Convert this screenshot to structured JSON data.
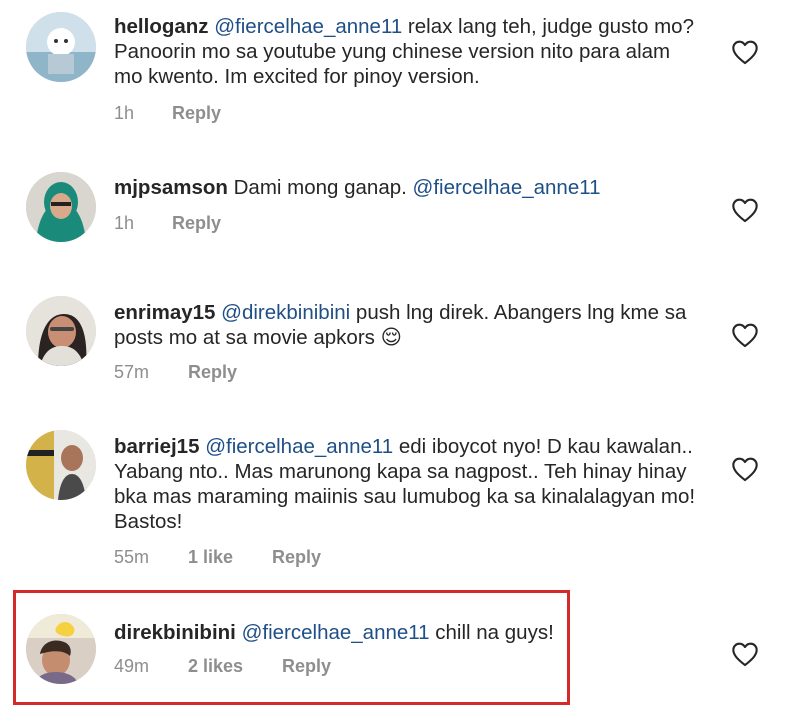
{
  "comments": [
    {
      "username": "helloganz",
      "mention": "@fiercelhae_anne11",
      "text": " relax lang teh, judge gusto mo? Panoorin mo sa youtube yung chinese version nito para alam mo kwento. Im excited for  pinoy version.",
      "time": "1h",
      "likes": "",
      "reply_label": "Reply",
      "avatar_icon": "cartoon-avatar"
    },
    {
      "username": "mjpsamson",
      "mention": "",
      "text": " Dami mong ganap. ",
      "mention_after": "@fiercelhae_anne11",
      "time": "1h",
      "likes": "",
      "reply_label": "Reply",
      "avatar_icon": "person-avatar"
    },
    {
      "username": "enrimay15",
      "mention": "@direkbinibini",
      "text": " push lng direk. Abangers lng kme sa posts mo at sa movie apkors 😌",
      "time": "57m",
      "likes": "",
      "reply_label": "Reply",
      "avatar_icon": "person-avatar"
    },
    {
      "username": "barriej15",
      "mention": "@fiercelhae_anne11",
      "text": " edi iboycot nyo! D kau kawalan.. Yabang nto.. Mas marunong kapa sa nagpost.. Teh hinay hinay bka mas maraming maiinis sau lumubog ka sa kinalalagyan mo! Bastos!",
      "time": "55m",
      "likes": "1 like",
      "reply_label": "Reply",
      "avatar_icon": "person-avatar"
    },
    {
      "username": "direkbinibini",
      "mention": "@fiercelhae_anne11",
      "text": " chill na guys!",
      "time": "49m",
      "likes": "2 likes",
      "reply_label": "Reply",
      "avatar_icon": "person-avatar",
      "highlighted": true
    }
  ],
  "colors": {
    "mention": "#1f4f87",
    "meta": "#8e8e8e",
    "highlight_border": "#d42a2a"
  }
}
